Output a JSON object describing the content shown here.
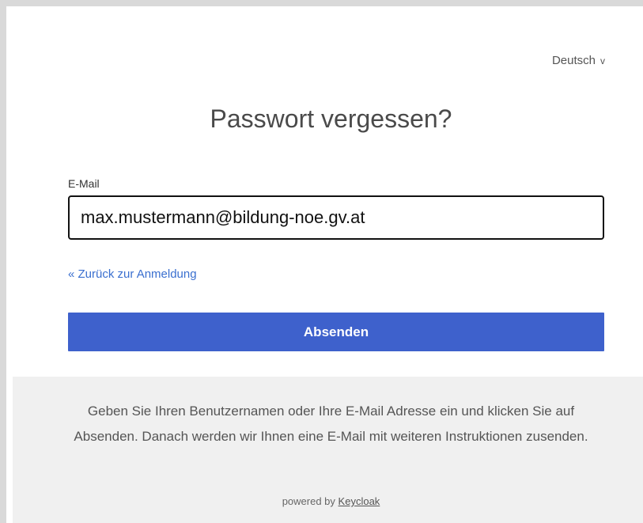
{
  "header": {
    "language": "Deutsch",
    "language_chevron": "v"
  },
  "form": {
    "title": "Passwort vergessen?",
    "email_label": "E-Mail",
    "email_value": "max.mustermann@bildung-noe.gv.at",
    "back_link": "« Zurück zur Anmeldung",
    "submit_label": "Absenden"
  },
  "info": {
    "text": "Geben Sie Ihren Benutzernamen oder Ihre E-Mail Adresse ein und klicken Sie auf Absenden. Danach werden wir Ihnen eine E-Mail mit weiteren Instruktionen zusenden.",
    "powered_prefix": "powered by",
    "powered_link": "Keycloak"
  },
  "colors": {
    "accent": "#3e61cc",
    "link": "#3a6fcf",
    "info_background": "#f0f0f0"
  }
}
